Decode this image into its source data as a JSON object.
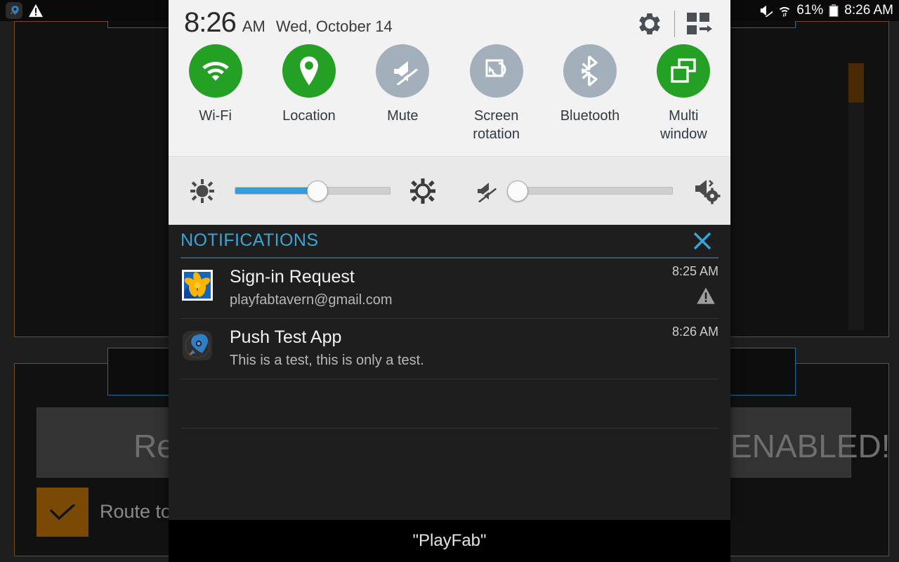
{
  "status_bar": {
    "left_icons": [
      {
        "name": "push-test-app-rocket-icon"
      },
      {
        "name": "warning-triangle-icon"
      }
    ],
    "mute_icon": "mute-icon",
    "wifi_icon": "wifi-data-icon",
    "battery_percent": "61%",
    "battery_icon": "battery-icon",
    "time": "8:26 AM"
  },
  "shade": {
    "clock": {
      "time": "8:26",
      "ampm": "AM",
      "date": "Wed, October 14"
    },
    "header_actions": {
      "settings_label": "gear-icon",
      "edit_toggles_label": "quick-settings-grid-icon"
    },
    "toggles": [
      {
        "label": "Wi-Fi",
        "icon": "wifi-icon",
        "state": "on"
      },
      {
        "label": "Location",
        "icon": "location-pin-icon",
        "state": "on"
      },
      {
        "label": "Mute",
        "icon": "mute-icon",
        "state": "off"
      },
      {
        "label": "Screen\nrotation",
        "icon": "screen-rotation-icon",
        "state": "off"
      },
      {
        "label": "Bluetooth",
        "icon": "bluetooth-icon",
        "state": "off"
      },
      {
        "label": "Multi\nwindow",
        "icon": "multi-window-icon",
        "state": "on"
      }
    ],
    "colors": {
      "toggle_on": "#24a024",
      "toggle_off": "#a3b0bb",
      "slider_fill": "#2e9fe0",
      "notifications_accent": "#36a5d8"
    },
    "brightness_slider": {
      "low_icon": "brightness-low-icon",
      "high_icon": "brightness-high-icon",
      "value": 53
    },
    "volume_slider": {
      "left_icon": "volume-mute-icon",
      "right_icon": "volume-settings-icon",
      "value": 0
    },
    "notifications": {
      "title": "NOTIFICATIONS",
      "clear_all_icon": "close-x-icon",
      "items": [
        {
          "icon": "gallery-flower-icon",
          "title": "Sign-in Request",
          "text": "playfabtavern@gmail.com",
          "time": "8:25 AM",
          "badge_icon": "warning-triangle-icon"
        },
        {
          "icon": "push-test-app-rocket-icon",
          "title": "Push Test App",
          "text": "This is a test, this is only a test.",
          "time": "8:26 AM",
          "badge_icon": ""
        }
      ]
    }
  },
  "toast": {
    "message": "\"PlayFab\""
  },
  "background_app": {
    "heading_text": "ENABLED!",
    "register_button_label": "Reg",
    "route_checkbox_label": "Route to",
    "checkbox_checked": true
  }
}
